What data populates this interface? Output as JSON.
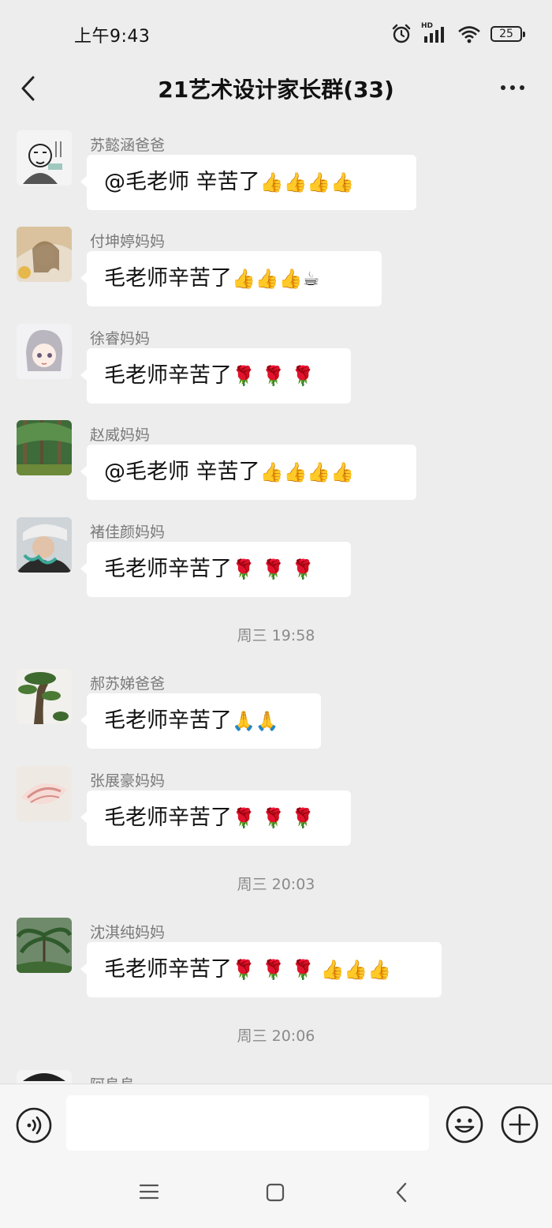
{
  "status_bar": {
    "time": "上午9:43",
    "battery": "25",
    "signal_label": "HD"
  },
  "header": {
    "title": "21艺术设计家长群(33)"
  },
  "messages": [
    {
      "sender": "苏懿涵爸爸",
      "text": "@毛老师  辛苦了",
      "emoji": "👍👍👍👍"
    },
    {
      "sender": "付坤婷妈妈",
      "text": "毛老师辛苦了",
      "emoji": "👍👍👍☕"
    },
    {
      "sender": "徐睿妈妈",
      "text": "毛老师辛苦了",
      "emoji": "🌹 🌹 🌹"
    },
    {
      "sender": "赵威妈妈",
      "text": "@毛老师  辛苦了",
      "emoji": "👍👍👍👍"
    },
    {
      "sender": "褚佳颜妈妈",
      "text": "毛老师辛苦了",
      "emoji": "🌹 🌹 🌹"
    },
    {
      "sender": "郝苏娣爸爸",
      "text": "毛老师辛苦了",
      "emoji": "🙏🙏"
    },
    {
      "sender": "张展豪妈妈",
      "text": "毛老师辛苦了",
      "emoji": "🌹 🌹 🌹"
    },
    {
      "sender": "沈淇纯妈妈",
      "text": "毛老师辛苦了",
      "emoji": "🌹 🌹 🌹 👍👍👍"
    },
    {
      "sender": "阿阜阜",
      "text": "",
      "emoji": ""
    }
  ],
  "timestamps": [
    "周三 19:58",
    "周三 20:03",
    "周三 20:06"
  ],
  "input": {
    "value": "",
    "placeholder": ""
  },
  "colors": {
    "background": "#ededed",
    "bubble": "#ffffff",
    "meta_text": "#8a8a8a"
  },
  "icons": {
    "back": "chevron-left-icon",
    "more": "more-dots-icon",
    "voice": "voice-icon",
    "emoji": "smiley-icon",
    "plus": "plus-icon"
  }
}
